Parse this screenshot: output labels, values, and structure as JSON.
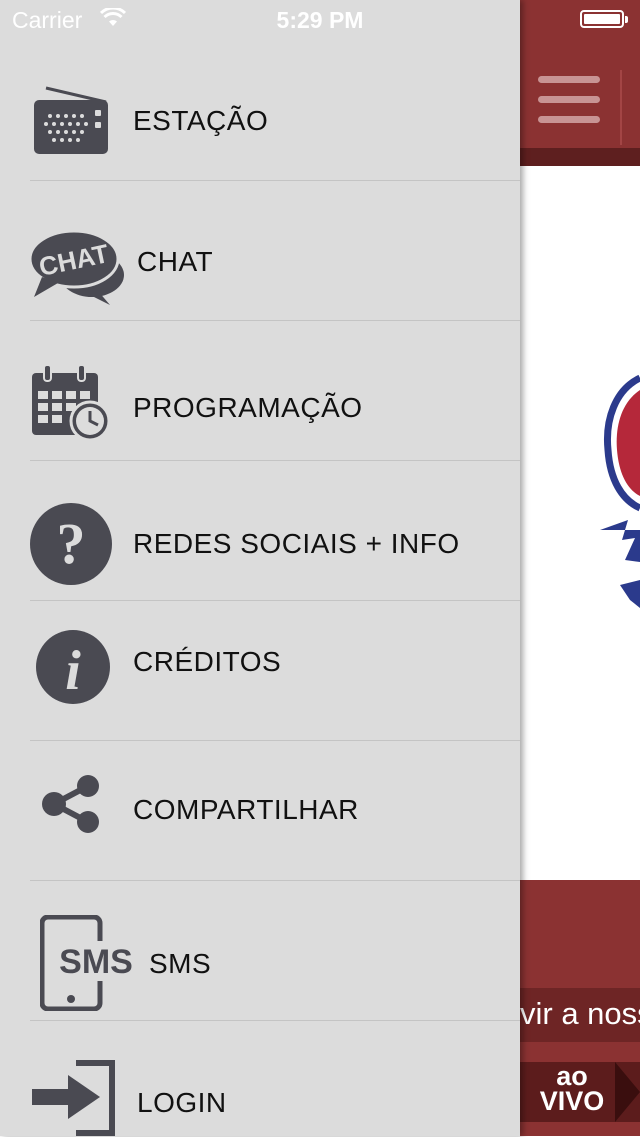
{
  "status_bar": {
    "carrier": "Carrier",
    "time": "5:29 PM"
  },
  "menu": {
    "items": [
      {
        "label": "ESTAÇÃO",
        "icon": "radio-icon"
      },
      {
        "label": "CHAT",
        "icon": "chat-bubbles-icon",
        "icon_text": "CHAT"
      },
      {
        "label": "PROGRAMAÇÃO",
        "icon": "calendar-clock-icon"
      },
      {
        "label": "REDES SOCIAIS + INFO",
        "icon": "question-icon"
      },
      {
        "label": "CRÉDITOS",
        "icon": "info-icon"
      },
      {
        "label": "COMPARTILHAR",
        "icon": "share-icon"
      },
      {
        "label": "SMS",
        "icon": "sms-phone-icon",
        "icon_text": "SMS"
      },
      {
        "label": "LOGIN",
        "icon": "login-icon"
      }
    ]
  },
  "main": {
    "ticker_text": "vir a noss",
    "live_badge": {
      "line1": "ao",
      "line2": "VIVO"
    }
  },
  "colors": {
    "header": "#8b3232",
    "drawer": "#dcdcdc",
    "icon": "#4a4a52"
  }
}
